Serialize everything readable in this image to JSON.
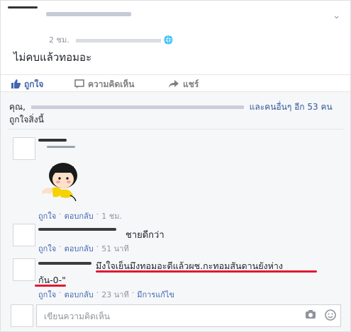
{
  "post": {
    "timestamp": "2 ชม.",
    "text": "ไม่คบแล้วทอมอะ",
    "menu_icon": "chevron-down-icon",
    "privacy_icon": "globe-icon"
  },
  "actions": {
    "like": "ถูกใจ",
    "comment": "ความคิดเห็น",
    "share": "แชร์"
  },
  "likes": {
    "prefix": "คุณ,",
    "and_others": "และคนอื่นๆ อีก 53 คน",
    "suffix": "ถูกใจสิ่งนี้"
  },
  "comments": [
    {
      "text": "",
      "sticker": "cartoon-girl-sticker",
      "like": "ถูกใจ",
      "reply": "ตอบกลับ",
      "time": "1 ชม."
    },
    {
      "text": "ชายดีกว่า",
      "like": "ถูกใจ",
      "reply": "ตอบกลับ",
      "time": "51 นาที"
    },
    {
      "text_line1": "มึงใจเย็นมึงทอมอะดีแล้วผช.กะทอมสันดานยังห่าง",
      "text_line2": "กัน-0-\"",
      "like": "ถูกใจ",
      "reply": "ตอบกลับ",
      "time": "23 นาที",
      "edited": "มีการแก้ไข"
    }
  ],
  "composer": {
    "placeholder": "เขียนความคิดเห็น",
    "camera_icon": "camera-icon",
    "emoji_icon": "emoji-icon"
  },
  "colors": {
    "link": "#4267b2",
    "underline": "#e0192e"
  }
}
